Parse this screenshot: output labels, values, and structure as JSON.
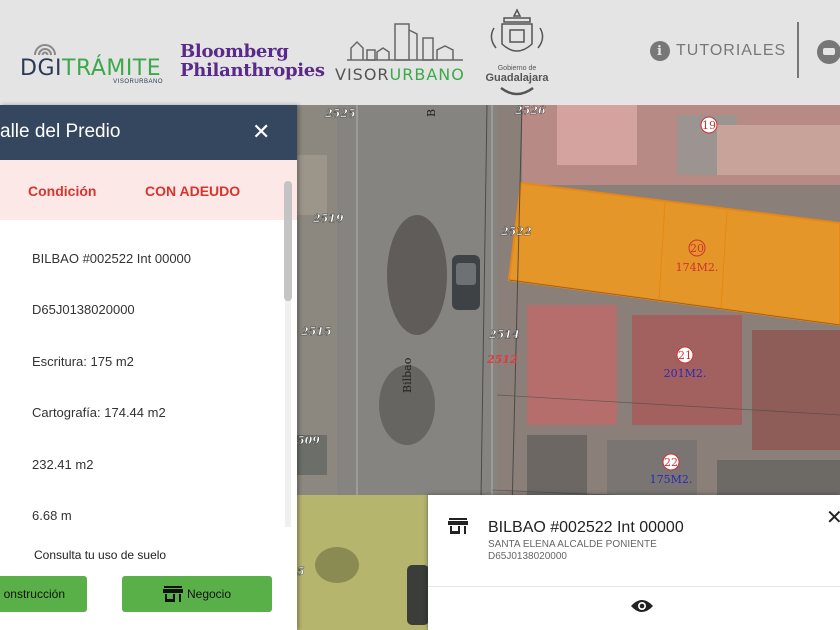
{
  "header": {
    "digitramite": {
      "part1": "D",
      "part2": "GI",
      "part3": "TRÁMITE",
      "sub": "VISORURBANO"
    },
    "bloomberg": {
      "line1": "Bloomberg",
      "line2": "Philanthropies"
    },
    "visorurbano": {
      "part1": "VISOR",
      "part2": "URBANO"
    },
    "guadalajara": {
      "line1": "Gobierno de",
      "line2": "Guadalajara"
    },
    "tutoriales_label": "TUTORIALES",
    "tutoriales_icon": "info-icon",
    "chat_icon": "chat-icon"
  },
  "map": {
    "labels": {
      "l2525": "2525",
      "l2526": "2526",
      "l2519": "2519",
      "l2522": "2522",
      "l2515": "2515",
      "l2514": "2514",
      "l2512": "2512",
      "l509": "509",
      "bilbao": "Bilbao",
      "b": "B",
      "lot19": "19",
      "lot20": "20",
      "area20": "174M2.",
      "lot21": "21",
      "area21": "201M2.",
      "lot22": "22",
      "area22": "175M2.",
      "l5": "5"
    },
    "highlight_color": "#f59a1b"
  },
  "panel": {
    "title": "alle del Predio",
    "close": "✕",
    "condition_label": "Condición",
    "condition_value": "CON ADEUDO",
    "rows": [
      "BILBAO #002522 Int 00000",
      "D65J0138020000",
      "Escritura: 175 m2",
      "Cartografía: 174.44 m2",
      "232.41 m2",
      "6.68 m"
    ],
    "uso_text": "Consulta tu uso de suelo",
    "btn_construccion": "onstrucción",
    "btn_negocio": "Negocio"
  },
  "card": {
    "title": "BILBAO #002522 Int 00000",
    "colonia": "SANTA ELENA ALCALDE PONIENTE",
    "clave": "D65J0138020000",
    "close": "✕"
  }
}
